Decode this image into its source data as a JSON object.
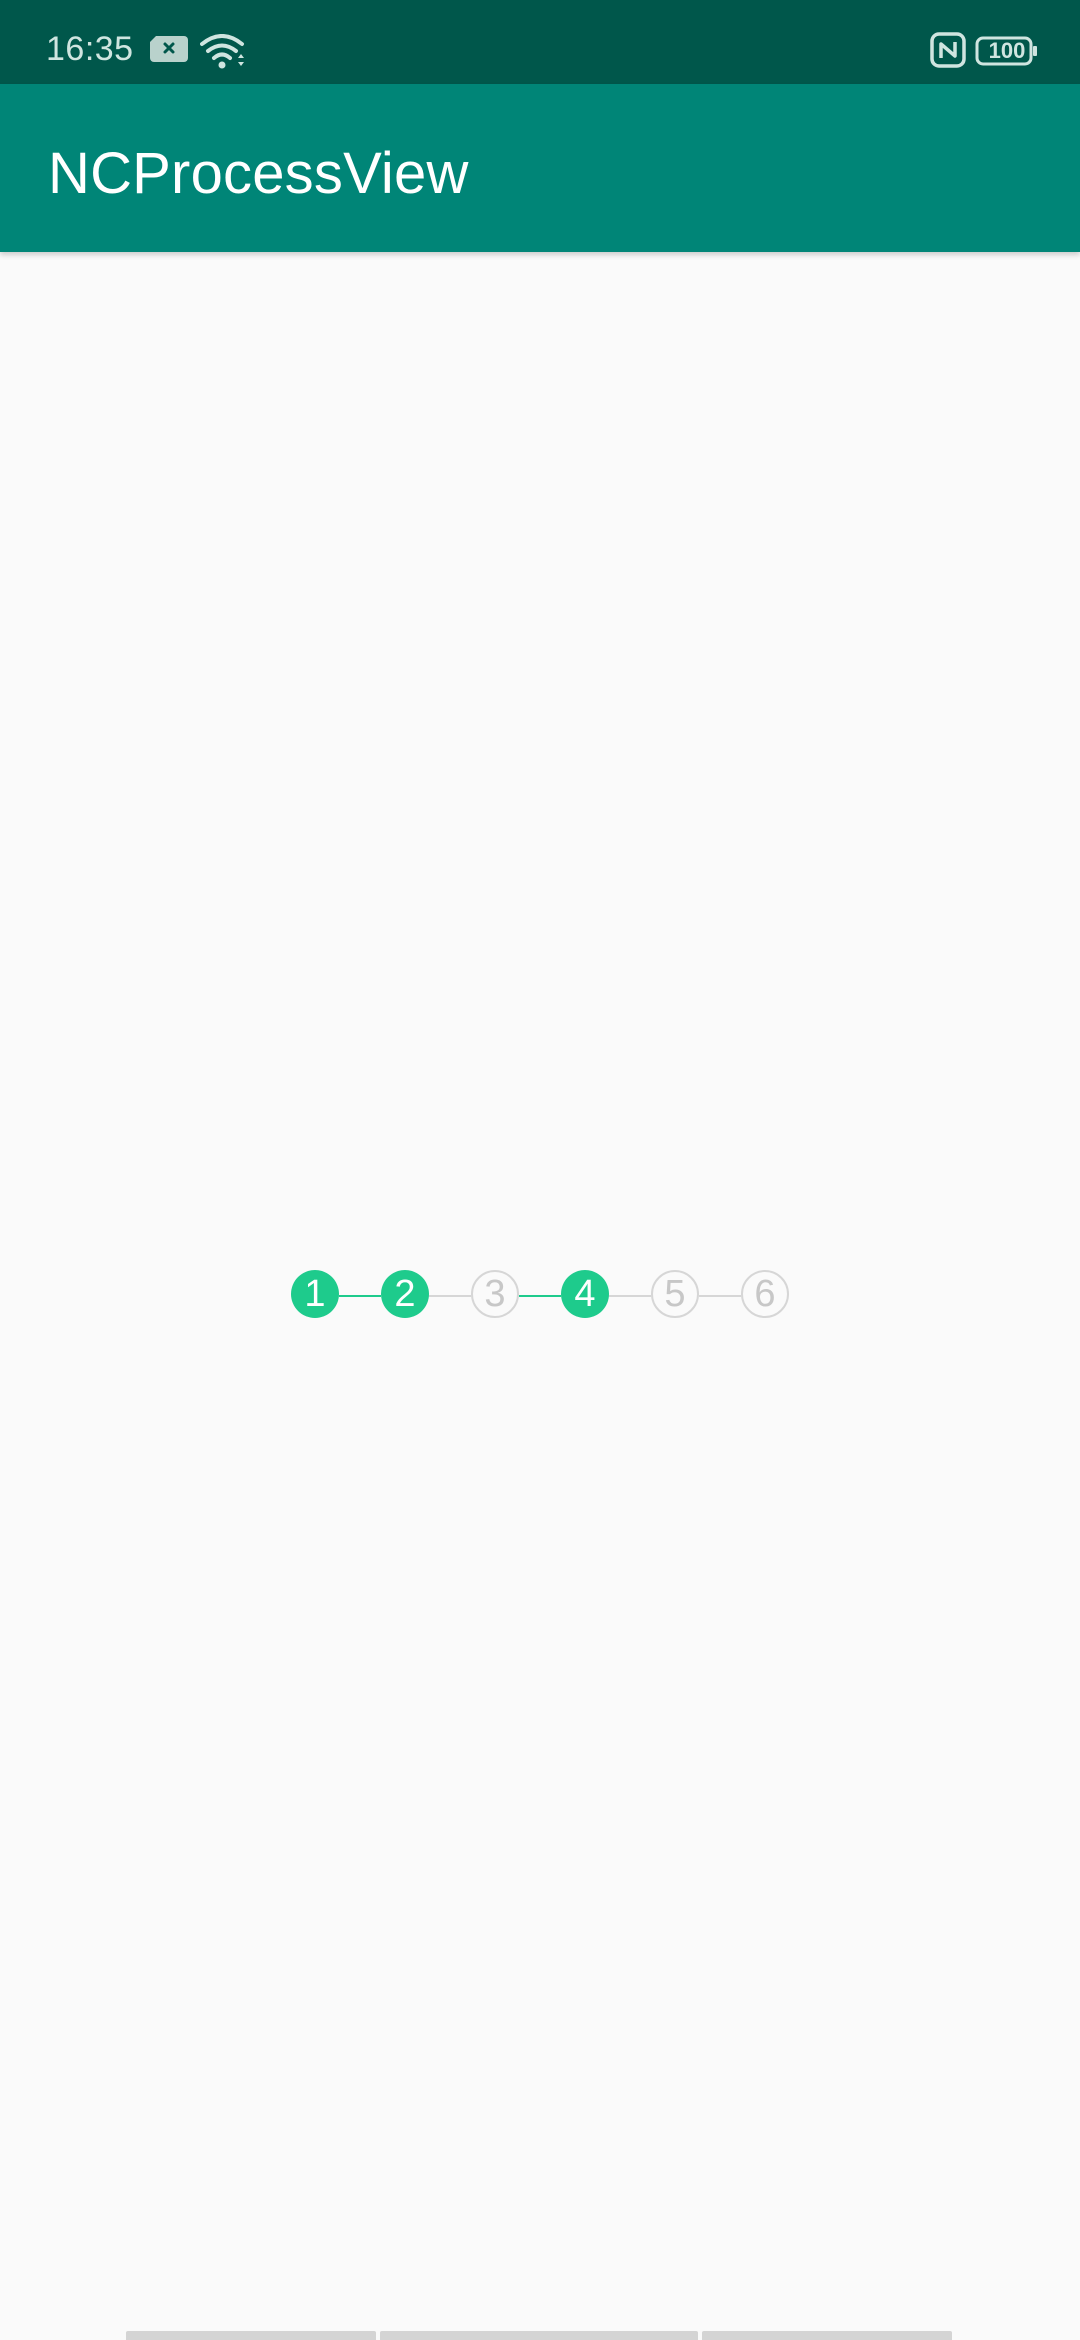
{
  "status_bar": {
    "time": "16:35",
    "battery": "100",
    "icons": [
      "sim-card-x-icon",
      "wifi-icon",
      "nfc-icon",
      "battery-icon"
    ]
  },
  "app_bar": {
    "title": "NCProcessView"
  },
  "process_view": {
    "steps": [
      {
        "label": "1",
        "state": "done"
      },
      {
        "label": "2",
        "state": "done"
      },
      {
        "label": "3",
        "state": "todo"
      },
      {
        "label": "4",
        "state": "done"
      },
      {
        "label": "5",
        "state": "todo"
      },
      {
        "label": "6",
        "state": "todo"
      }
    ]
  },
  "colors": {
    "status_bar": "#00574b",
    "app_bar": "#008577",
    "step_done": "#1ecb8c",
    "step_todo_border": "#d6d6d6",
    "background": "#fafafa"
  }
}
